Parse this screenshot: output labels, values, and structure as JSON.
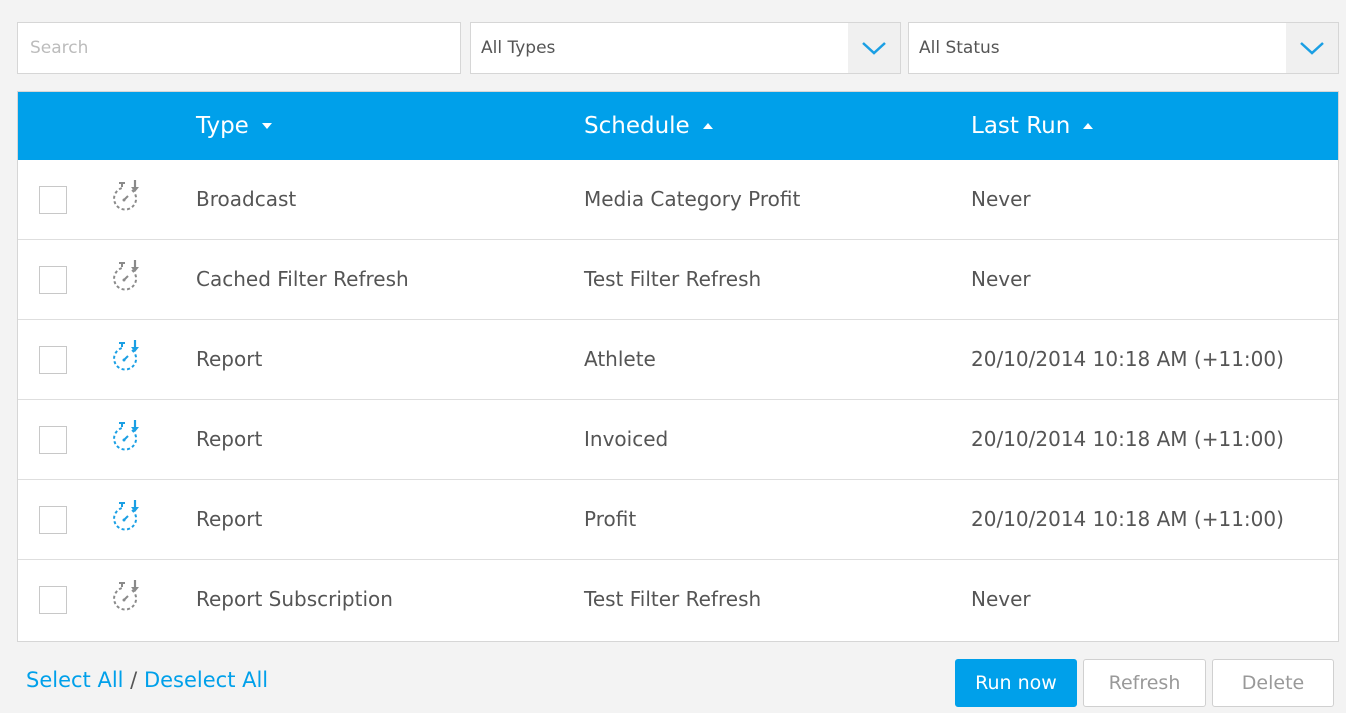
{
  "filters": {
    "search_placeholder": "Search",
    "type_selected": "All Types",
    "status_selected": "All Status"
  },
  "table": {
    "headers": {
      "type": "Type",
      "schedule": "Schedule",
      "last_run": "Last Run"
    },
    "sort_indicators": {
      "type": "chevron-down-icon",
      "schedule": "sort-asc-icon",
      "last_run": "sort-asc-icon"
    },
    "rows": [
      {
        "type": "Broadcast",
        "schedule": "Media Category Profit",
        "last_run": "Never",
        "checked": false,
        "icon": "stopwatch-icon",
        "icon_active": false
      },
      {
        "type": "Cached Filter Refresh",
        "schedule": "Test Filter Refresh",
        "last_run": "Never",
        "checked": false,
        "icon": "stopwatch-icon",
        "icon_active": false
      },
      {
        "type": "Report",
        "schedule": "Athlete",
        "last_run": "20/10/2014 10:18 AM (+11:00)",
        "checked": false,
        "icon": "stopwatch-icon",
        "icon_active": true
      },
      {
        "type": "Report",
        "schedule": "Invoiced",
        "last_run": "20/10/2014 10:18 AM (+11:00)",
        "checked": false,
        "icon": "stopwatch-icon",
        "icon_active": true
      },
      {
        "type": "Report",
        "schedule": "Profit",
        "last_run": "20/10/2014 10:18 AM (+11:00)",
        "checked": false,
        "icon": "stopwatch-icon",
        "icon_active": true
      },
      {
        "type": "Report Subscription",
        "schedule": "Test Filter Refresh",
        "last_run": "Never",
        "checked": false,
        "icon": "stopwatch-icon",
        "icon_active": false
      }
    ]
  },
  "footer": {
    "select_all": "Select All",
    "separator": " / ",
    "deselect_all": "Deselect All",
    "run_now": "Run now",
    "refresh": "Refresh",
    "delete": "Delete"
  },
  "colors": {
    "accent": "#00a0ea",
    "icon_active": "#1a9fe4",
    "icon_inactive": "#8a8a8a",
    "header_text": "#ffffff"
  }
}
